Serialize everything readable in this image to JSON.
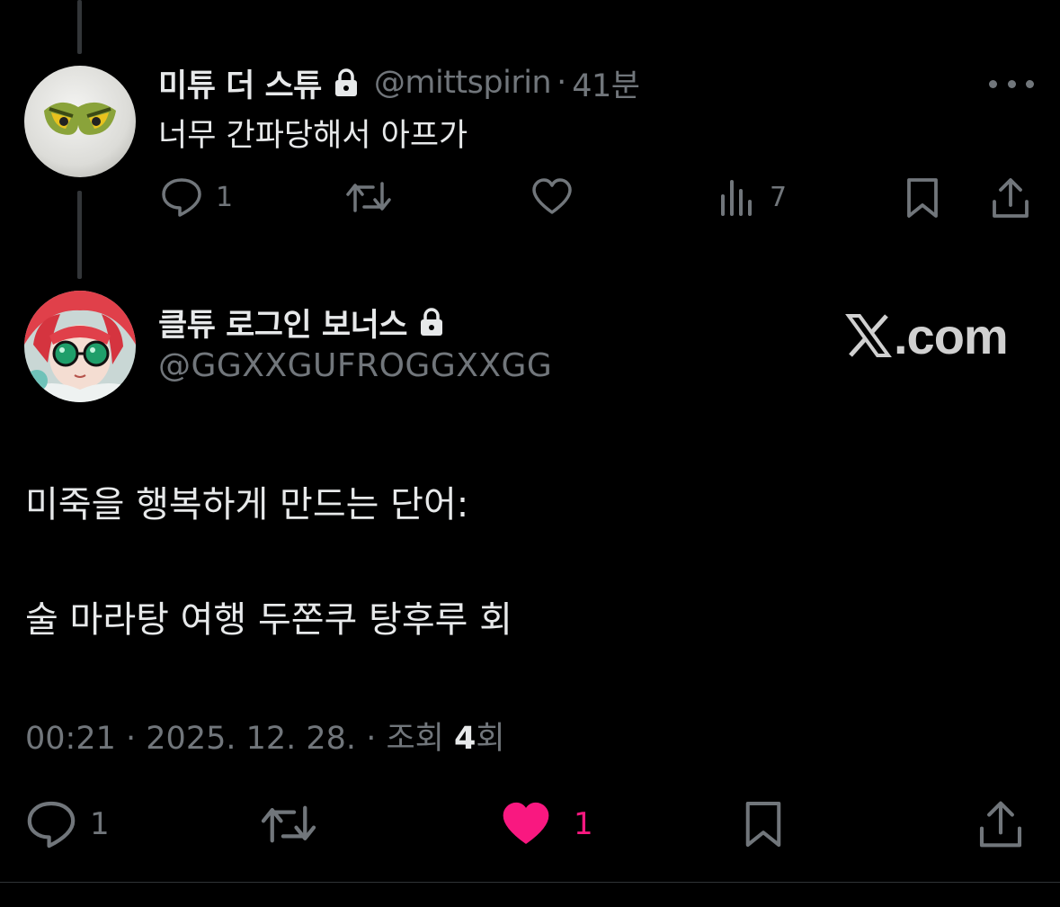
{
  "reply_tweet": {
    "display_name": "미튜 더 스튜",
    "handle": "@mittspirin",
    "separator": "·",
    "time": "41분",
    "text": "너무 간파당해서 아프가",
    "avatar_icon": "grinch-eyes-avatar",
    "actions": {
      "reply_count": "1",
      "views_count": "7"
    }
  },
  "main_tweet": {
    "display_name": "클튜 로그인 보너스",
    "handle": "@GGXXGUFROGGXXGG",
    "avatar_icon": "anime-girl-avatar",
    "body": [
      "미죽을 행복하게 만드는 단어:",
      "술 마라탕 여행 두쫀쿠 탕후루 회"
    ],
    "meta": {
      "time": "00:21",
      "date": "2025. 12. 28.",
      "views_label": "조회",
      "views_count": "4",
      "views_suffix": "회"
    },
    "actions": {
      "reply_count": "1",
      "like_count": "1"
    }
  },
  "watermark": {
    "text": ".com",
    "icon": "x-logo-icon"
  },
  "colors": {
    "background": "#000000",
    "text_primary": "#e7e9ea",
    "text_secondary": "#71767b",
    "like_active": "#f91880"
  }
}
